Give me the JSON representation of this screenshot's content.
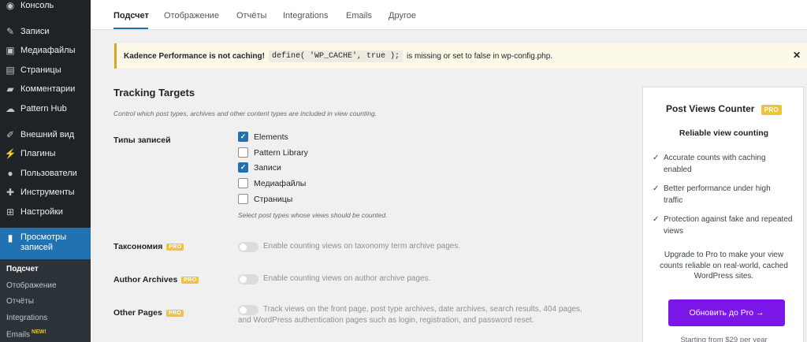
{
  "sidebar": {
    "items": [
      {
        "label": "Консоль",
        "icon": "dashboard-icon"
      },
      {
        "label": "Записи",
        "icon": "pin-icon"
      },
      {
        "label": "Медиафайлы",
        "icon": "media-icon"
      },
      {
        "label": "Страницы",
        "icon": "page-icon"
      },
      {
        "label": "Комментарии",
        "icon": "comment-icon"
      },
      {
        "label": "Pattern Hub",
        "icon": "cloud-icon"
      },
      {
        "label": "Внешний вид",
        "icon": "brush-icon"
      },
      {
        "label": "Плагины",
        "icon": "plugin-icon"
      },
      {
        "label": "Пользователи",
        "icon": "user-icon"
      },
      {
        "label": "Инструменты",
        "icon": "wrench-icon"
      },
      {
        "label": "Настройки",
        "icon": "settings-icon"
      }
    ],
    "active": {
      "label": "Просмотры записей",
      "icon": "bar-chart-icon"
    },
    "submenu": [
      {
        "label": "Подсчет"
      },
      {
        "label": "Отображение"
      },
      {
        "label": "Отчёты"
      },
      {
        "label": "Integrations"
      },
      {
        "label": "Emails",
        "badge": "NEW!"
      }
    ]
  },
  "tabs": [
    "Подсчет",
    "Отображение",
    "Отчёты",
    "Integrations",
    "Emails",
    "Другое"
  ],
  "notice": {
    "bold": "Kadence Performance is not caching!",
    "code": "define( 'WP_CACHE', true );",
    "text": "is missing or set to false in wp-config.php.",
    "close": "✕"
  },
  "section": {
    "title": "Tracking Targets",
    "description": "Control which post types, archives and other content types are included in view counting."
  },
  "post_types": {
    "label": "Типы записей",
    "options": [
      {
        "label": "Elements",
        "checked": true
      },
      {
        "label": "Pattern Library",
        "checked": false
      },
      {
        "label": "Записи",
        "checked": true
      },
      {
        "label": "Медиафайлы",
        "checked": false
      },
      {
        "label": "Страницы",
        "checked": false
      }
    ],
    "hint": "Select post types whose views should be counted."
  },
  "pro_badge": "PRO",
  "taxonomy": {
    "label": "Таксономия",
    "text": "Enable counting views on taxonomy term archive pages."
  },
  "author": {
    "label": "Author Archives",
    "text": "Enable counting views on author archive pages."
  },
  "other": {
    "label": "Other Pages",
    "text1": "Track views on the front page, post type archives, date archives, search results, 404 pages,",
    "text2": "and WordPress authentication pages such as login, registration, and password reset."
  },
  "promo": {
    "title": "Post Views Counter",
    "badge": "PRO",
    "subtitle": "Reliable view counting",
    "features": [
      {
        "line1": "Accurate counts with caching",
        "line2": "enabled"
      },
      {
        "line1": "Better performance under high",
        "line2": "traffic"
      },
      {
        "line1": "Protection against fake and repeated",
        "line2": "views"
      }
    ],
    "note1": "Upgrade to Pro to make your view",
    "note2": "counts reliable on real-world, cached",
    "note3": "WordPress sites.",
    "button": "Обновить до Pro →",
    "price": "Starting from $29 per year"
  },
  "colors": {
    "accent": "#2271b1",
    "sidebar": "#1d2327",
    "pro": "#f0c33c",
    "upgrade": "#7b17e6"
  }
}
